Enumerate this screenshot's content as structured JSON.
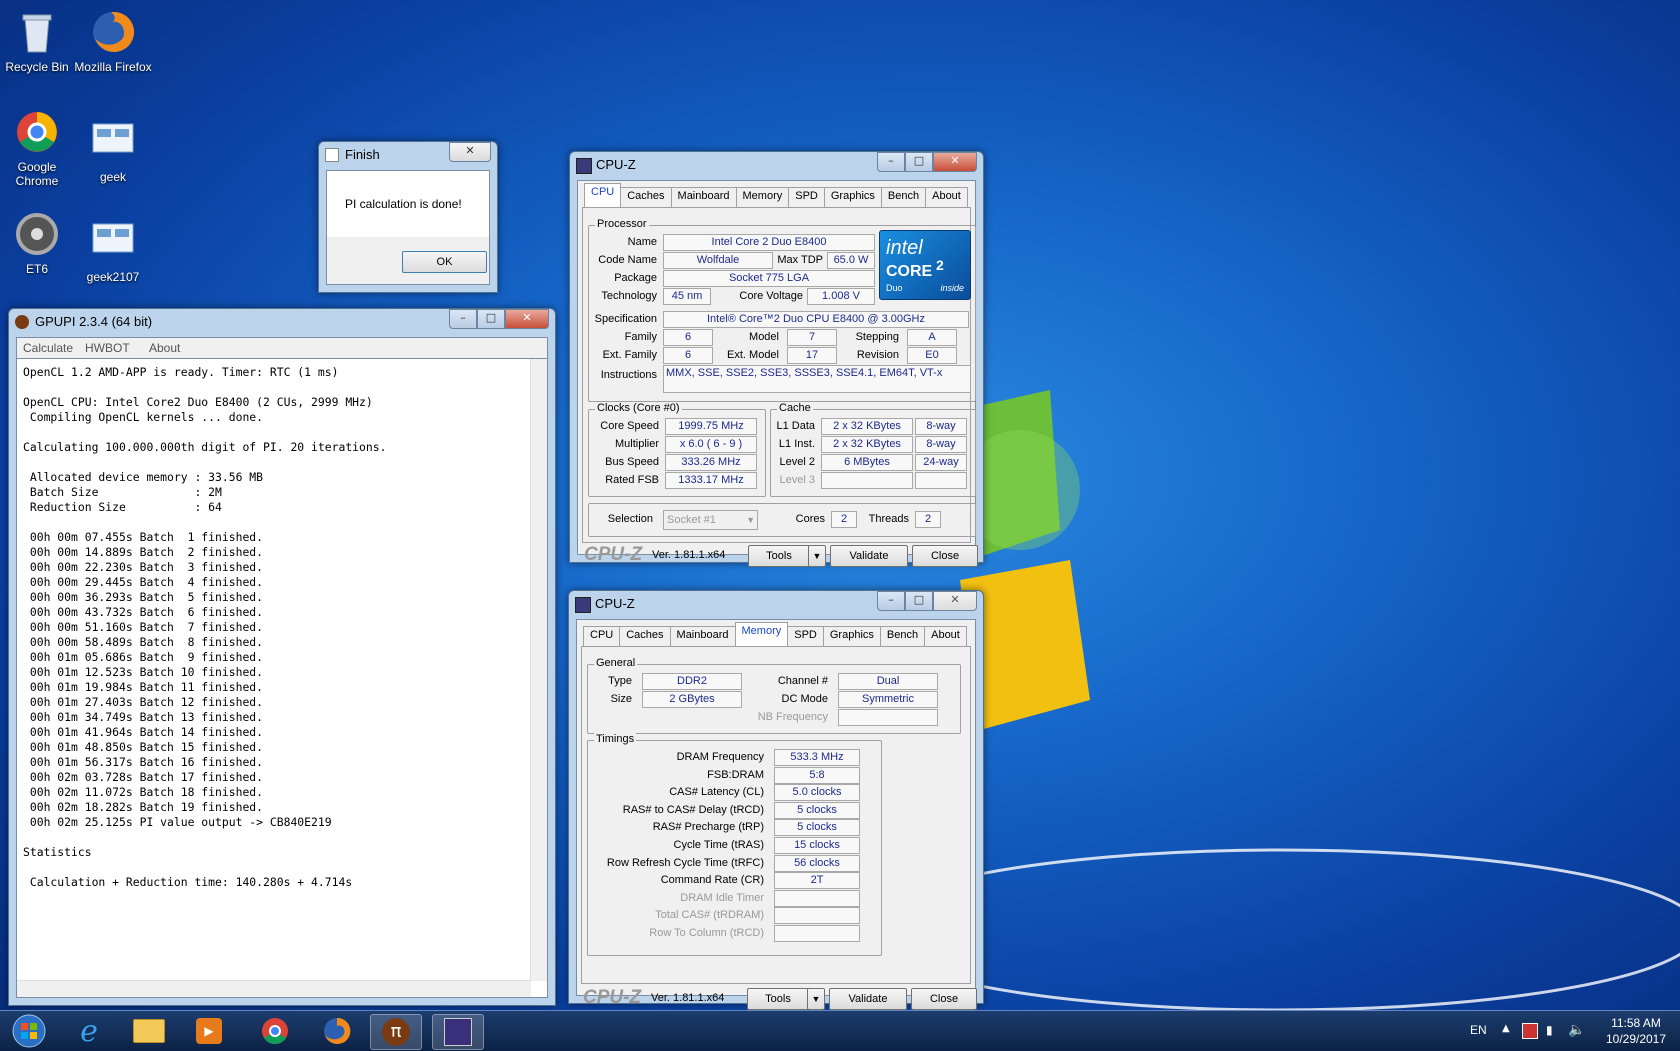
{
  "desktop": {
    "icons": [
      {
        "label": "Recycle Bin"
      },
      {
        "label": "Mozilla Firefox"
      },
      {
        "label": "Google Chrome"
      },
      {
        "label": "geek"
      },
      {
        "label": "ET6"
      },
      {
        "label": "geek2107"
      }
    ]
  },
  "finish_dialog": {
    "title": "Finish",
    "message": "PI calculation is done!",
    "ok_label": "OK",
    "close_glyph": "✕"
  },
  "gpupi": {
    "title": "GPUPI 2.3.4 (64 bit)",
    "menu": [
      "Calculate",
      "HWBOT",
      "About"
    ],
    "log": [
      "OpenCL 1.2 AMD-APP is ready. Timer: RTC (1 ms)",
      "",
      "OpenCL CPU: Intel Core2 Duo E8400 (2 CUs, 2999 MHz)",
      " Compiling OpenCL kernels ... done.",
      "",
      "Calculating 100.000.000th digit of PI. 20 iterations.",
      "",
      " Allocated device memory : 33.56 MB",
      " Batch Size              : 2M",
      " Reduction Size          : 64",
      "",
      " 00h 00m 07.455s Batch  1 finished.",
      " 00h 00m 14.889s Batch  2 finished.",
      " 00h 00m 22.230s Batch  3 finished.",
      " 00h 00m 29.445s Batch  4 finished.",
      " 00h 00m 36.293s Batch  5 finished.",
      " 00h 00m 43.732s Batch  6 finished.",
      " 00h 00m 51.160s Batch  7 finished.",
      " 00h 00m 58.489s Batch  8 finished.",
      " 00h 01m 05.686s Batch  9 finished.",
      " 00h 01m 12.523s Batch 10 finished.",
      " 00h 01m 19.984s Batch 11 finished.",
      " 00h 01m 27.403s Batch 12 finished.",
      " 00h 01m 34.749s Batch 13 finished.",
      " 00h 01m 41.964s Batch 14 finished.",
      " 00h 01m 48.850s Batch 15 finished.",
      " 00h 01m 56.317s Batch 16 finished.",
      " 00h 02m 03.728s Batch 17 finished.",
      " 00h 02m 11.072s Batch 18 finished.",
      " 00h 02m 18.282s Batch 19 finished.",
      " 00h 02m 25.125s PI value output -> CB840E219",
      "",
      "Statistics",
      "",
      " Calculation + Reduction time: 140.280s + 4.714s"
    ]
  },
  "cpuz_cpu": {
    "title": "CPU-Z",
    "tabs": [
      "CPU",
      "Caches",
      "Mainboard",
      "Memory",
      "SPD",
      "Graphics",
      "Bench",
      "About"
    ],
    "active_tab": "CPU",
    "processor_legend": "Processor",
    "name_label": "Name",
    "name": "Intel Core 2 Duo E8400",
    "codename_label": "Code Name",
    "codename": "Wolfdale",
    "maxtdp_label": "Max TDP",
    "maxtdp": "65.0 W",
    "package_label": "Package",
    "package": "Socket 775 LGA",
    "technology_label": "Technology",
    "technology": "45 nm",
    "corevoltage_label": "Core Voltage",
    "corevoltage": "1.008 V",
    "spec_label": "Specification",
    "spec": "Intel® Core™2 Duo CPU     E8400  @ 3.00GHz",
    "family_label": "Family",
    "family": "6",
    "model_label": "Model",
    "model": "7",
    "stepping_label": "Stepping",
    "stepping": "A",
    "extfamily_label": "Ext. Family",
    "extfamily": "6",
    "extmodel_label": "Ext. Model",
    "extmodel": "17",
    "revision_label": "Revision",
    "revision": "E0",
    "instructions_label": "Instructions",
    "instructions": "MMX, SSE, SSE2, SSE3, SSSE3, SSE4.1, EM64T, VT-x",
    "clocks_legend": "Clocks (Core #0)",
    "corespeed_label": "Core Speed",
    "corespeed": "1999.75 MHz",
    "multiplier_label": "Multiplier",
    "multiplier": "x 6.0 ( 6 - 9 )",
    "busspeed_label": "Bus Speed",
    "busspeed": "333.26 MHz",
    "ratedfsb_label": "Rated FSB",
    "ratedfsb": "1333.17 MHz",
    "cache_legend": "Cache",
    "l1data_label": "L1 Data",
    "l1data": "2 x 32 KBytes",
    "l1data_way": "8-way",
    "l1inst_label": "L1 Inst.",
    "l1inst": "2 x 32 KBytes",
    "l1inst_way": "8-way",
    "level2_label": "Level 2",
    "level2": "6 MBytes",
    "level2_way": "24-way",
    "level3_label": "Level 3",
    "selection_label": "Selection",
    "selection": "Socket #1",
    "cores_label": "Cores",
    "cores": "2",
    "threads_label": "Threads",
    "threads": "2",
    "logo_text": "CPU-Z",
    "version": "Ver. 1.81.1.x64",
    "tools_label": "Tools",
    "validate_label": "Validate",
    "close_label": "Close",
    "intel_badge": {
      "brand": "intel",
      "line": "CORE",
      "sup": "2",
      "sub": "Duo",
      "inside": "inside"
    }
  },
  "cpuz_mem": {
    "title": "CPU-Z",
    "tabs": [
      "CPU",
      "Caches",
      "Mainboard",
      "Memory",
      "SPD",
      "Graphics",
      "Bench",
      "About"
    ],
    "active_tab": "Memory",
    "general_legend": "General",
    "type_label": "Type",
    "type": "DDR2",
    "size_label": "Size",
    "size": "2 GBytes",
    "channel_label": "Channel #",
    "channel": "Dual",
    "dcmode_label": "DC Mode",
    "dcmode": "Symmetric",
    "nbfreq_label": "NB Frequency",
    "timings_legend": "Timings",
    "timings": [
      {
        "label": "DRAM Frequency",
        "value": "533.3 MHz",
        "disabled": false
      },
      {
        "label": "FSB:DRAM",
        "value": "5:8",
        "disabled": false
      },
      {
        "label": "CAS# Latency (CL)",
        "value": "5.0 clocks",
        "disabled": false
      },
      {
        "label": "RAS# to CAS# Delay (tRCD)",
        "value": "5 clocks",
        "disabled": false
      },
      {
        "label": "RAS# Precharge (tRP)",
        "value": "5 clocks",
        "disabled": false
      },
      {
        "label": "Cycle Time (tRAS)",
        "value": "15 clocks",
        "disabled": false
      },
      {
        "label": "Row Refresh Cycle Time (tRFC)",
        "value": "56 clocks",
        "disabled": false
      },
      {
        "label": "Command Rate (CR)",
        "value": "2T",
        "disabled": false
      },
      {
        "label": "DRAM Idle Timer",
        "value": "",
        "disabled": true
      },
      {
        "label": "Total CAS# (tRDRAM)",
        "value": "",
        "disabled": true
      },
      {
        "label": "Row To Column (tRCD)",
        "value": "",
        "disabled": true
      }
    ],
    "logo_text": "CPU-Z",
    "version": "Ver. 1.81.1.x64",
    "tools_label": "Tools",
    "validate_label": "Validate",
    "close_label": "Close"
  },
  "taskbar": {
    "language": "EN",
    "time": "11:58 AM",
    "date": "10/29/2017"
  },
  "colors": {
    "cpuz_value_text": "#1d2a8c",
    "active_tab_text": "#1a46c8",
    "intel_blue": "#0a5fb4"
  }
}
